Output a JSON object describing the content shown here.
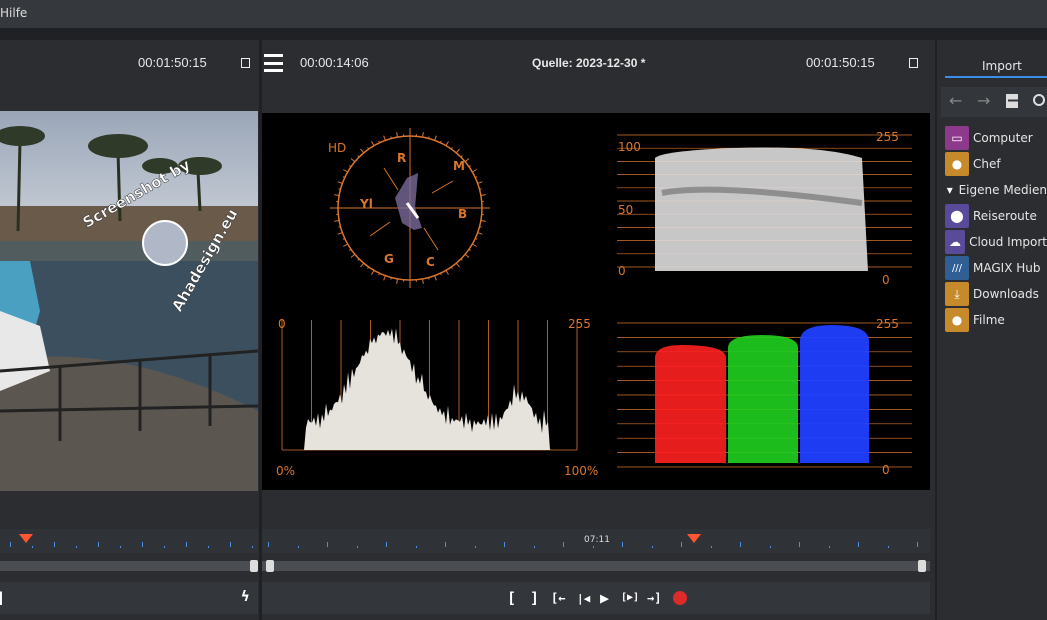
{
  "menu": {
    "help": "Hilfe"
  },
  "player": {
    "left_timecode": "00:01:50:15",
    "position_timecode": "00:00:14:06",
    "source_title": "Quelle: 2023-12-30 *",
    "right_timecode": "00:01:50:15",
    "ruler_time": "07:11",
    "watermark": "Screenshot by Ahadesign.eu"
  },
  "scopes": {
    "vectorscope": {
      "label": "HD",
      "targets": [
        "R",
        "M",
        "B",
        "C",
        "G",
        "Yl"
      ]
    },
    "waveform": {
      "left_ticks": [
        "100",
        "50",
        "0"
      ],
      "right_ticks": [
        "255",
        "0"
      ]
    },
    "histogram": {
      "top_left": "0",
      "top_right": "255",
      "bottom_left": "0%",
      "bottom_right": "100%"
    },
    "parade": {
      "right_ticks": [
        "255",
        "0"
      ],
      "colors": [
        "#ff2020",
        "#20e020",
        "#2040ff"
      ]
    }
  },
  "transport": [
    "[",
    "]",
    "[←",
    "|◀",
    "▶",
    "[▶]",
    "→]",
    "record"
  ],
  "sidebar": {
    "tab": "Import",
    "items": [
      {
        "label": "Computer",
        "icon": "laptop-icon",
        "color": "#8e3a8c"
      },
      {
        "label": "Chef",
        "icon": "user-icon",
        "color": "#c78a2a"
      },
      {
        "label": "Eigene Medien",
        "icon": "triangle-down-icon",
        "color": ""
      },
      {
        "label": "Reiseroute",
        "icon": "location-pin-icon",
        "color": "#5a4a9a"
      },
      {
        "label": "Cloud Import",
        "icon": "cloud-icon",
        "color": "#5a4a9a"
      },
      {
        "label": "MAGIX Hub",
        "icon": "magix-icon",
        "color": "#2f5f95"
      },
      {
        "label": "Downloads",
        "icon": "download-icon",
        "color": "#c78a2a"
      },
      {
        "label": "Filme",
        "icon": "user-icon",
        "color": "#c78a2a"
      }
    ]
  }
}
